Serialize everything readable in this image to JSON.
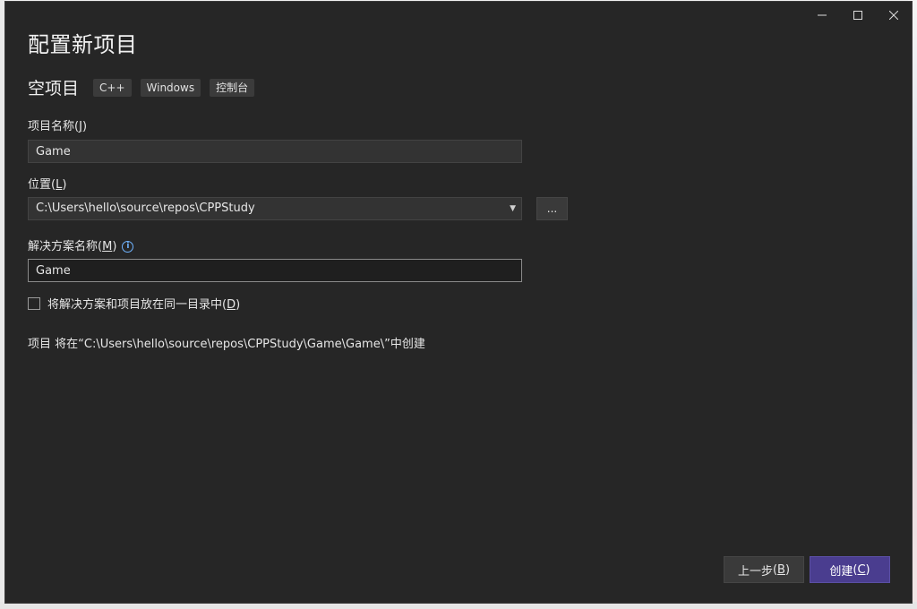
{
  "window": {
    "minimize_label": "minimize",
    "maximize_label": "maximize",
    "close_label": "close"
  },
  "page_title": "配置新项目",
  "template": {
    "name": "空项目",
    "tags": [
      "C++",
      "Windows",
      "控制台"
    ]
  },
  "project_name": {
    "label": "项目名称",
    "mnemonic": "J",
    "value": "Game"
  },
  "location": {
    "label": "位置",
    "mnemonic": "L",
    "value": "C:\\Users\\hello\\source\\repos\\CPPStudy",
    "browse_label": "..."
  },
  "solution_name": {
    "label": "解决方案名称",
    "mnemonic": "M",
    "value": "Game"
  },
  "same_dir_checkbox": {
    "label": "将解决方案和项目放在同一目录中",
    "mnemonic": "D",
    "checked": false
  },
  "path_info": "项目 将在“C:\\Users\\hello\\source\\repos\\CPPStudy\\Game\\Game\\”中创建",
  "buttons": {
    "back_label": "上一步",
    "back_mnemonic": "B",
    "create_label": "创建",
    "create_mnemonic": "C"
  },
  "colors": {
    "dialog_bg": "#262626",
    "accent": "#4a3d8f",
    "info_icon": "#6fb3ff"
  }
}
